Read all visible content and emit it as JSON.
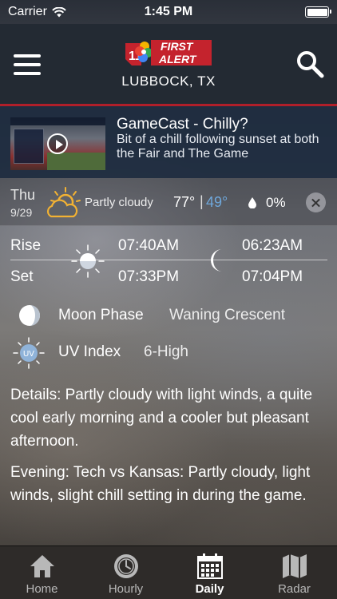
{
  "status_bar": {
    "carrier": "Carrier",
    "time": "1:45 PM"
  },
  "header": {
    "logo_text_top": "FIRST",
    "logo_text_bottom": "ALERT",
    "logo_number": "11",
    "city": "LUBBOCK, TX"
  },
  "news": {
    "title": "GameCast - Chilly?",
    "description": "Bit of a chill following sunset at both the Fair and The Game"
  },
  "day": {
    "name": "Thu",
    "date": "9/29",
    "condition": "Partly cloudy",
    "high": "77°",
    "separator": "|",
    "low": "49°",
    "precip": "0%",
    "low_color": "#6fa8dc"
  },
  "sun_moon": {
    "rise_label": "Rise",
    "set_label": "Set",
    "sunrise": "07:40AM",
    "sunset": "07:33PM",
    "moonrise": "06:23AM",
    "moonset": "07:04PM"
  },
  "moon_phase": {
    "label": "Moon Phase",
    "value": "Waning Crescent"
  },
  "uv": {
    "icon_text": "UV",
    "label": "UV Index",
    "value": "6-High"
  },
  "forecast": {
    "details": "Details: Partly cloudy with light winds, a quite cool early morning and a cooler but pleasant afternoon.",
    "evening": "Evening: Tech vs Kansas: Partly cloudy, light winds, slight chill setting in during the game."
  },
  "tabs": [
    {
      "label": "Home",
      "icon": "home-icon"
    },
    {
      "label": "Hourly",
      "icon": "clock-icon"
    },
    {
      "label": "Daily",
      "icon": "calendar-icon"
    },
    {
      "label": "Radar",
      "icon": "map-icon"
    }
  ],
  "colors": {
    "accent_red": "#b01f2a",
    "header_bg": "#232a33",
    "news_bg": "#1c2a3e"
  }
}
